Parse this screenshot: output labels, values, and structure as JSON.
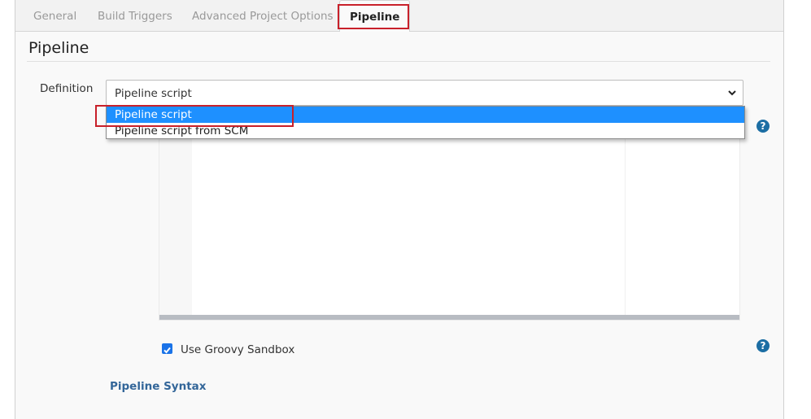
{
  "tabs": [
    {
      "label": "General",
      "active": false
    },
    {
      "label": "Build Triggers",
      "active": false
    },
    {
      "label": "Advanced Project Options",
      "active": false
    },
    {
      "label": "Pipeline",
      "active": true
    }
  ],
  "section": {
    "title": "Pipeline"
  },
  "definition": {
    "label": "Definition",
    "selected": "Pipeline script",
    "options": [
      "Pipeline script",
      "Pipeline script from SCM"
    ],
    "highlighted_option": "Pipeline script"
  },
  "editor": {
    "content": ""
  },
  "sandbox": {
    "label": "Use Groovy Sandbox",
    "checked": true
  },
  "links": {
    "pipeline_syntax": "Pipeline Syntax"
  },
  "help_icon": "?",
  "colors": {
    "highlight_box": "#c8202a",
    "selected_option": "#1e90ff",
    "help_icon": "#1c6ea4",
    "link": "#336699"
  }
}
